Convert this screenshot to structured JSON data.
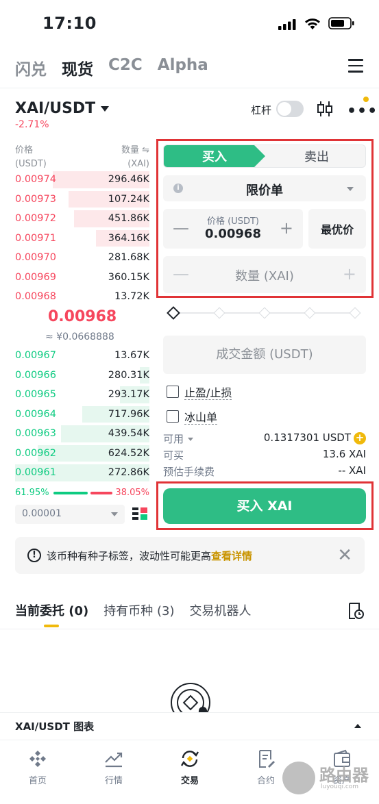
{
  "status_bar": {
    "time": "17:10"
  },
  "top_tabs": [
    "闪兑",
    "现货",
    "C2C",
    "Alpha"
  ],
  "active_top_tab": 1,
  "pair": {
    "symbol": "XAI/USDT",
    "change": "-2.71%",
    "leverage_label": "杠杆"
  },
  "orderbook": {
    "price_header": "价格",
    "price_unit": "(USDT)",
    "qty_header": "数量 ⇋",
    "qty_unit": "(XAI)",
    "asks": [
      {
        "price": "0.00974",
        "qty": "296.46K",
        "depth": 0.72
      },
      {
        "price": "0.00973",
        "qty": "107.24K",
        "depth": 0.6
      },
      {
        "price": "0.00972",
        "qty": "451.86K",
        "depth": 0.56
      },
      {
        "price": "0.00971",
        "qty": "364.16K",
        "depth": 0.4
      },
      {
        "price": "0.00970",
        "qty": "281.68K",
        "depth": 0
      },
      {
        "price": "0.00969",
        "qty": "360.15K",
        "depth": 0
      },
      {
        "price": "0.00968",
        "qty": "13.72K",
        "depth": 0
      }
    ],
    "mid_price": "0.00968",
    "mid_fiat": "≈ ¥0.0668888",
    "bids": [
      {
        "price": "0.00967",
        "qty": "13.67K",
        "depth": 0
      },
      {
        "price": "0.00966",
        "qty": "280.31K",
        "depth": 0.07
      },
      {
        "price": "0.00965",
        "qty": "293.17K",
        "depth": 0.22
      },
      {
        "price": "0.00964",
        "qty": "717.96K",
        "depth": 0.5
      },
      {
        "price": "0.00963",
        "qty": "439.54K",
        "depth": 0.66
      },
      {
        "price": "0.00962",
        "qty": "624.52K",
        "depth": 0.83
      },
      {
        "price": "0.00961",
        "qty": "272.86K",
        "depth": 1.0
      }
    ],
    "buy_ratio": "61.95%",
    "sell_ratio": "38.05%",
    "depth_value": "0.00001"
  },
  "order_form": {
    "buy_tab": "买入",
    "sell_tab": "卖出",
    "order_type": "限价单",
    "price_placeholder": "价格 (USDT)",
    "price_value": "0.00968",
    "best_price": "最优价",
    "qty_placeholder": "数量 (XAI)",
    "amount_placeholder": "成交金额 (USDT)",
    "tpsl": "止盈/止损",
    "iceberg": "冰山单",
    "available_label": "可用",
    "available_value": "0.1317301 USDT",
    "can_buy_label": "可买",
    "can_buy_value": "13.6 XAI",
    "fee_label": "预估手续费",
    "fee_value": "-- XAI",
    "buy_button": "买入 XAI"
  },
  "notice": {
    "text": "该币种有种子标签，波动性可能更高",
    "link": "查看详情"
  },
  "bottom_tabs": [
    "当前委托 (0)",
    "持有币种 (3)",
    "交易机器人"
  ],
  "chart_bar_title": "XAI/USDT 图表",
  "nav": [
    "首页",
    "行情",
    "交易",
    "合约",
    "资产"
  ],
  "watermark": {
    "main": "路由器",
    "sub": "luyouqi.com"
  },
  "colors": {
    "green": "#2ebd85",
    "red": "#f6465d",
    "yellow": "#f0b90b"
  }
}
